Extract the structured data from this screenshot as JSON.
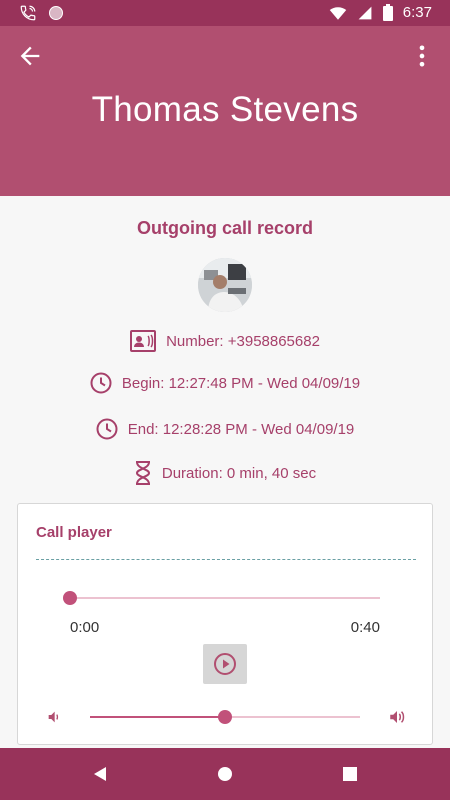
{
  "status_bar": {
    "time": "6:37",
    "icons": [
      "wifi-call-icon",
      "circle-icon",
      "wifi-icon",
      "signal-icon",
      "battery-icon"
    ]
  },
  "app_bar": {
    "title": "Thomas Stevens",
    "back_icon": "arrow-left-icon",
    "menu_icon": "more-vert-icon"
  },
  "record": {
    "heading": "Outgoing call record",
    "number": "Number: +3958865682",
    "begin": "Begin: 12:27:48 PM - Wed 04/09/19",
    "end": "End: 12:28:28 PM - Wed 04/09/19",
    "duration": "Duration: 0 min, 40 sec"
  },
  "player": {
    "title": "Call player",
    "time_start": "0:00",
    "time_end": "0:40",
    "seek_fraction": 0.0,
    "volume_fraction": 0.5
  },
  "colors": {
    "primary": "#b14f70",
    "primary_dark": "#98335a",
    "accent": "#a6406a"
  },
  "nav_bar": {
    "icons": [
      "back-triangle-icon",
      "home-circle-icon",
      "recents-square-icon"
    ]
  }
}
